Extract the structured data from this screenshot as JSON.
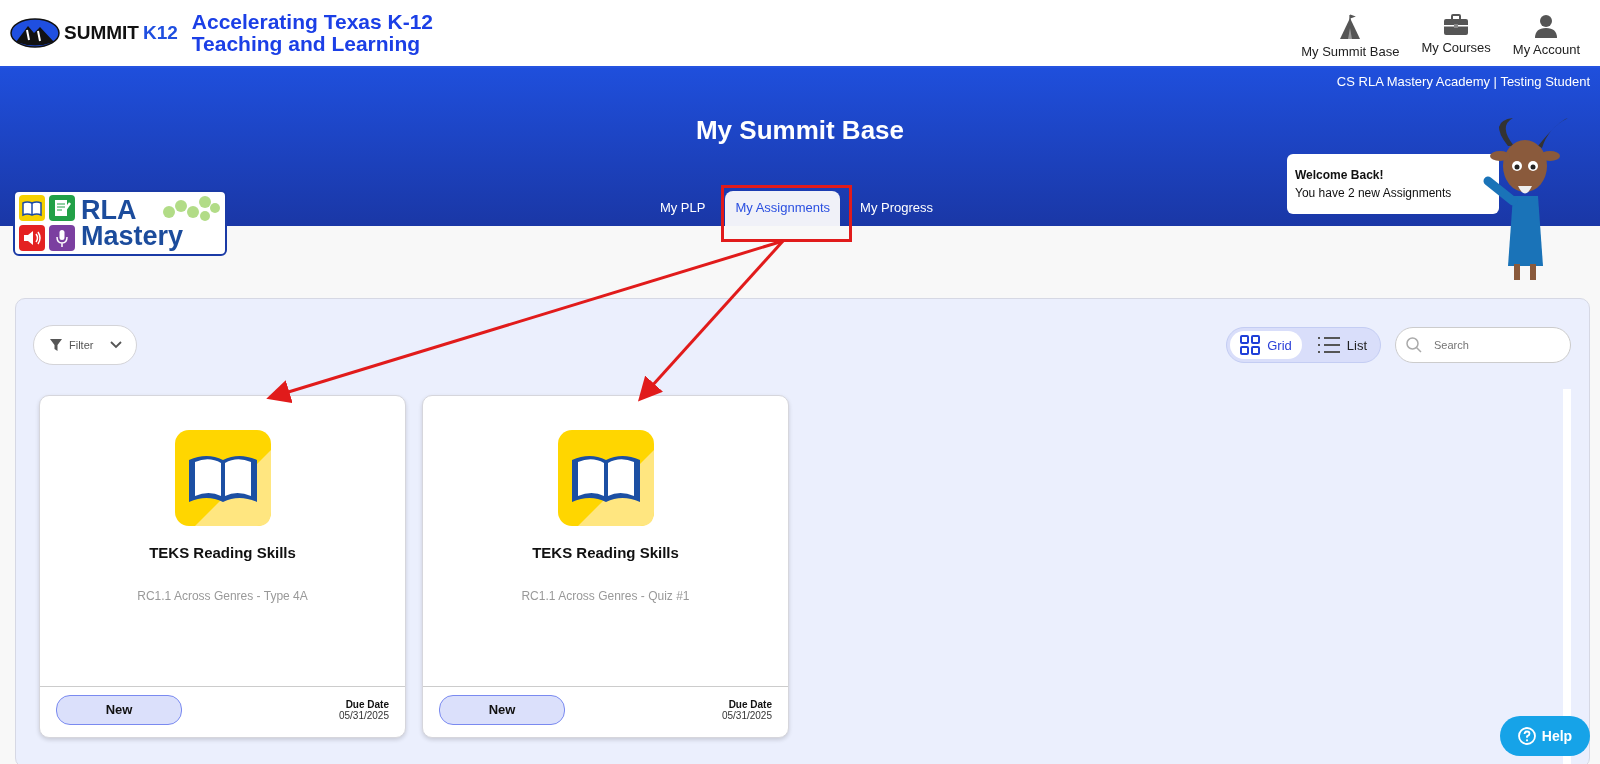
{
  "brand": {
    "name": "SUMMIT",
    "suffix": "K12",
    "tagline": [
      "Accelerating Texas K-12",
      "Teaching and Learning"
    ]
  },
  "top_nav": [
    {
      "label": "My Summit Base"
    },
    {
      "label": "My Courses"
    },
    {
      "label": "My Account"
    }
  ],
  "banner": {
    "context": "CS RLA Mastery Academy | Testing Student",
    "title": "My Summit Base"
  },
  "program_logo": {
    "line1": "RLA",
    "line2": "Mastery"
  },
  "tabs": [
    {
      "label": "My PLP",
      "selected": false
    },
    {
      "label": "My Assignments",
      "selected": true
    },
    {
      "label": "My Progress",
      "selected": false
    }
  ],
  "welcome": {
    "title": "Welcome Back!",
    "message": "You have 2 new Assignments"
  },
  "toolbar": {
    "filter": "Filter",
    "views": [
      {
        "label": "Grid",
        "selected": true
      },
      {
        "label": "List",
        "selected": false
      }
    ],
    "search": {
      "placeholder": "Search"
    }
  },
  "assignments": [
    {
      "title": "TEKS Reading Skills",
      "subtitle": "RC1.1 Across Genres - Type 4A",
      "status": "New",
      "due_label": "Due Date",
      "due": "05/31/2025"
    },
    {
      "title": "TEKS Reading Skills",
      "subtitle": "RC1.1 Across Genres - Quiz #1",
      "status": "New",
      "due_label": "Due Date",
      "due": "05/31/2025"
    }
  ],
  "help": "Help"
}
